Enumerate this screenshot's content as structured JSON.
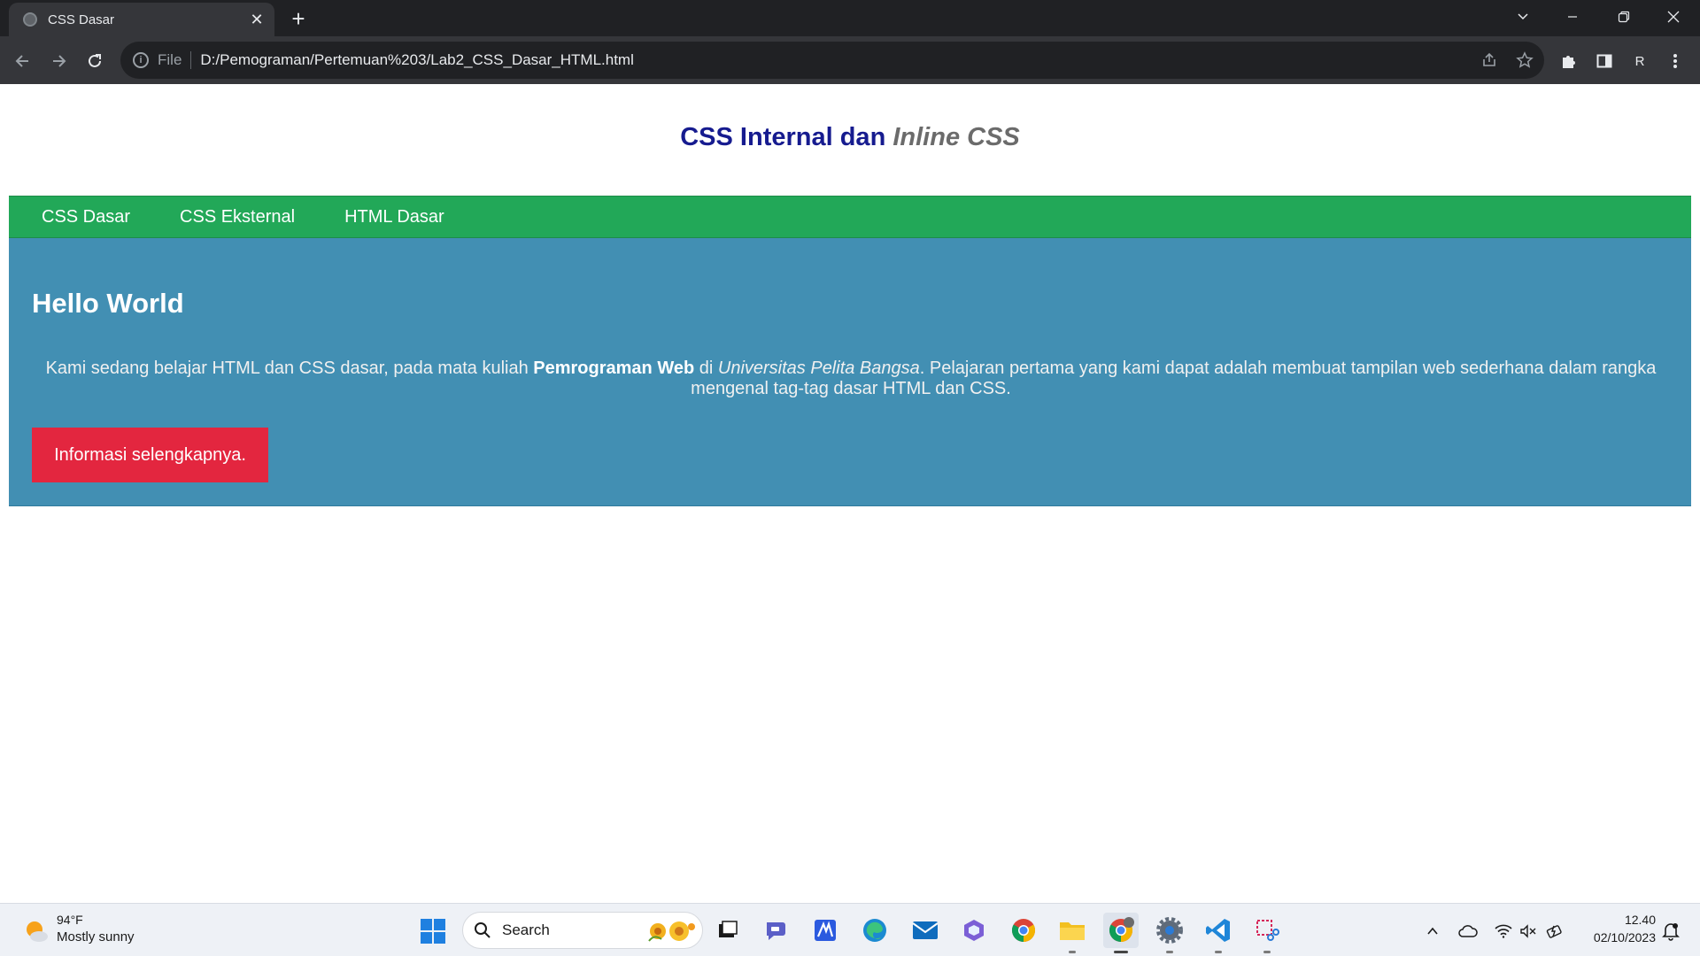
{
  "browser": {
    "tab_title": "CSS Dasar",
    "tab_close": "✕",
    "new_tab": "+",
    "address_scheme": "File",
    "address_url": "D:/Pemograman/Pertemuan%203/Lab2_CSS_Dasar_HTML.html",
    "profile_initial": "R"
  },
  "page": {
    "header": {
      "title_main": "CSS Internal dan ",
      "title_inline": "Inline CSS"
    },
    "nav": {
      "items": [
        "CSS Dasar",
        "CSS Eksternal",
        "HTML Dasar"
      ]
    },
    "main": {
      "heading": "Hello World",
      "para_part1": "Kami sedang belajar HTML dan CSS dasar, pada mata kuliah ",
      "para_bold": "Pemrograman Web",
      "para_part2": " di ",
      "para_italic": "Universitas Pelita Bangsa",
      "para_part3": ". Pelajaran pertama yang kami dapat adalah membuat tampilan web sederhana dalam rangka mengenal tag-tag dasar HTML dan CSS.",
      "button_label": "Informasi selengkapnya."
    },
    "colors": {
      "header_title": "#161b8f",
      "nav_bg": "#22a858",
      "main_bg": "#428fb3",
      "button_bg": "#e3263f"
    }
  },
  "taskbar": {
    "weather_temp": "94°F",
    "weather_desc": "Mostly sunny",
    "search_label": "Search",
    "clock_time": "12.40",
    "clock_date": "02/10/2023",
    "apps": [
      "task-view",
      "teams-chat",
      "mathpix",
      "edge",
      "mail",
      "copilot",
      "chrome",
      "file-explorer",
      "chrome-profile",
      "settings",
      "vscode",
      "snipping-tool"
    ]
  }
}
